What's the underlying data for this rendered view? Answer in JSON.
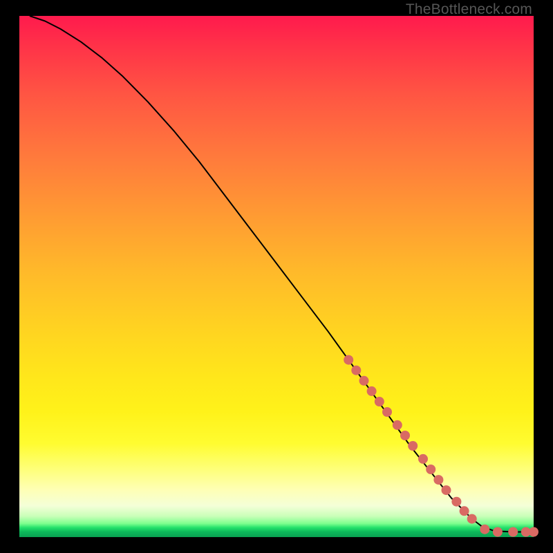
{
  "attribution": "TheBottleneck.com",
  "colors": {
    "dot": "#d96a63",
    "line": "#000000",
    "gradient_top": "#ff1a4d",
    "gradient_bottom": "#0aa052"
  },
  "chart_data": {
    "type": "line",
    "title": "",
    "xlabel": "",
    "ylabel": "",
    "xlim": [
      0,
      100
    ],
    "ylim": [
      0,
      100
    ],
    "annotations": [],
    "note": "No visible axis tick labels in the image; x and y values are read off the plot area (0–100 each axis). Curve starts near (2,100), gentle shoulder, then near-linear descent to the floor around x≈90 where it flattens to y≈1.",
    "series": [
      {
        "name": "curve",
        "x": [
          2,
          5,
          8,
          12,
          16,
          20,
          25,
          30,
          35,
          40,
          45,
          50,
          55,
          60,
          64,
          68,
          72,
          76,
          80,
          84,
          88,
          90,
          92,
          94,
          96,
          98,
          100
        ],
        "y": [
          100,
          99,
          97.5,
          95,
          92,
          88.5,
          83.5,
          78,
          72,
          65.5,
          59,
          52.5,
          46,
          39.5,
          34,
          28.5,
          23,
          17.5,
          12.5,
          7.5,
          3.5,
          2,
          1.3,
          1.1,
          1.0,
          1.0,
          1.0
        ]
      }
    ],
    "scatter_points": {
      "name": "highlighted-segment-dots",
      "note": "Thick salmon dots overlaid on the lower portion of the curve and along the floor.",
      "x": [
        64,
        65.5,
        67,
        68.5,
        70,
        71.5,
        73.5,
        75,
        76.5,
        78.5,
        80,
        81.5,
        83,
        85,
        86.5,
        88,
        90.5,
        93,
        96,
        98.5,
        100
      ],
      "y": [
        34,
        32,
        30,
        28,
        26,
        24,
        21.5,
        19.5,
        17.5,
        15,
        13,
        11,
        9,
        6.8,
        5,
        3.5,
        1.5,
        1.0,
        1.0,
        1.0,
        1.0
      ]
    }
  }
}
